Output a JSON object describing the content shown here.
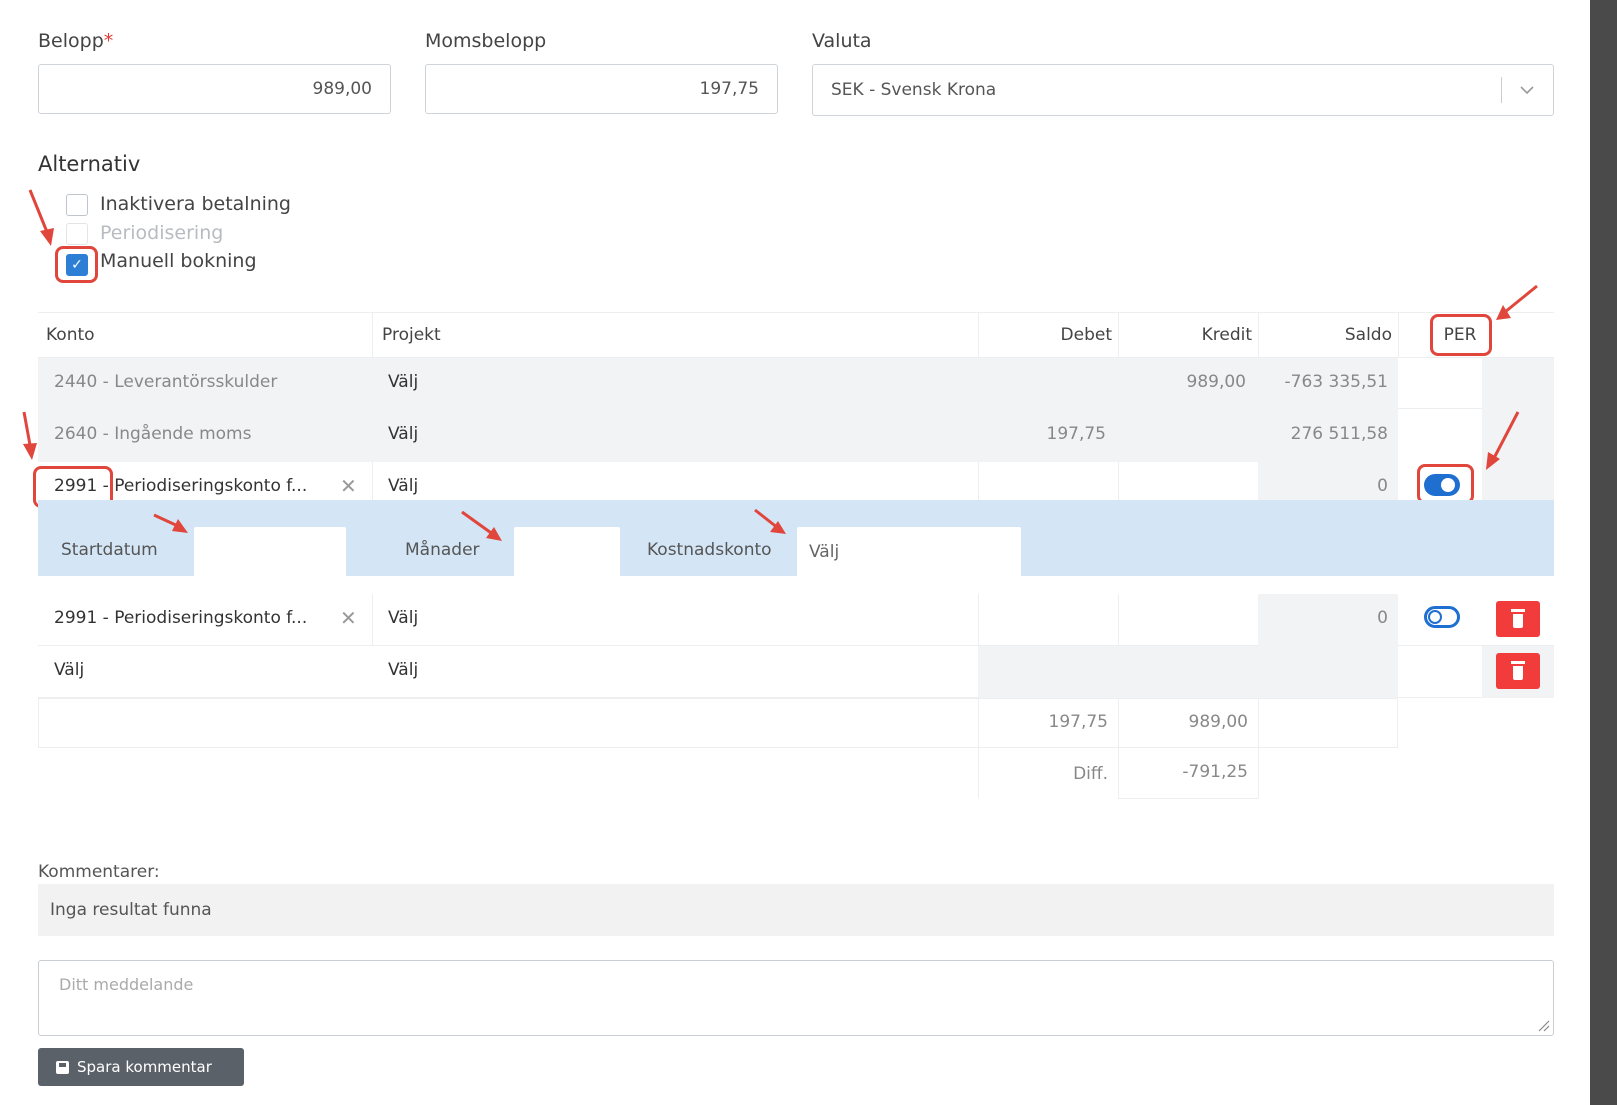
{
  "fields": {
    "belopp": {
      "label": "Belopp",
      "required_mark": "*",
      "value": "989,00"
    },
    "momsbelopp": {
      "label": "Momsbelopp",
      "value": "197,75"
    },
    "valuta": {
      "label": "Valuta",
      "value": "SEK - Svensk Krona"
    }
  },
  "alternativ": {
    "title": "Alternativ",
    "options": [
      {
        "label": "Inaktivera betalning",
        "checked": false,
        "disabled": false
      },
      {
        "label": "Periodisering",
        "checked": false,
        "disabled": true
      },
      {
        "label": "Manuell bokning",
        "checked": true,
        "disabled": false
      }
    ]
  },
  "table": {
    "headers": {
      "konto": "Konto",
      "projekt": "Projekt",
      "debet": "Debet",
      "kredit": "Kredit",
      "saldo": "Saldo",
      "per": "PER"
    },
    "rows": [
      {
        "konto": "2440 - Leverantörsskulder",
        "projekt": "Välj",
        "debet": "",
        "kredit": "989,00",
        "saldo": "-763 335,51"
      },
      {
        "konto": "2640 - Ingående moms",
        "projekt": "Välj",
        "debet": "197,75",
        "kredit": "",
        "saldo": "276 511,58"
      },
      {
        "konto": "2991 - Periodiseringskonto f...",
        "projekt": "Välj",
        "debet": "",
        "kredit": "",
        "saldo": "0",
        "per": "on"
      },
      {
        "konto": "2991 - Periodiseringskonto f...",
        "projekt": "Välj",
        "debet": "",
        "kredit": "",
        "saldo": "0",
        "per": "off"
      },
      {
        "konto": "Välj",
        "projekt": "Välj",
        "debet": "",
        "kredit": "",
        "saldo": ""
      }
    ],
    "clear_glyph": "✕",
    "period": {
      "startdatum": "Startdatum",
      "manader": "Månader",
      "kostnadskonto": "Kostnadskonto",
      "kostnadskonto_value": "Välj"
    },
    "totals": {
      "debet": "197,75",
      "kredit": "989,00"
    },
    "diff": {
      "label": "Diff.",
      "value": "-791,25"
    }
  },
  "comments": {
    "label": "Kommentarer:",
    "empty_text": "Inga resultat funna",
    "placeholder": "Ditt meddelande",
    "save_label": "Spara kommentar"
  },
  "colors": {
    "accent": "#1f6fd1",
    "danger": "#f23b3b",
    "annotation": "#e0463c",
    "period_bg": "#d4e6f6"
  },
  "icons": [
    "chevron-down-icon",
    "check-icon",
    "clear-icon",
    "toggle-icon",
    "trash-icon",
    "save-icon",
    "resize-handle-icon",
    "annotation-arrow-icon"
  ]
}
